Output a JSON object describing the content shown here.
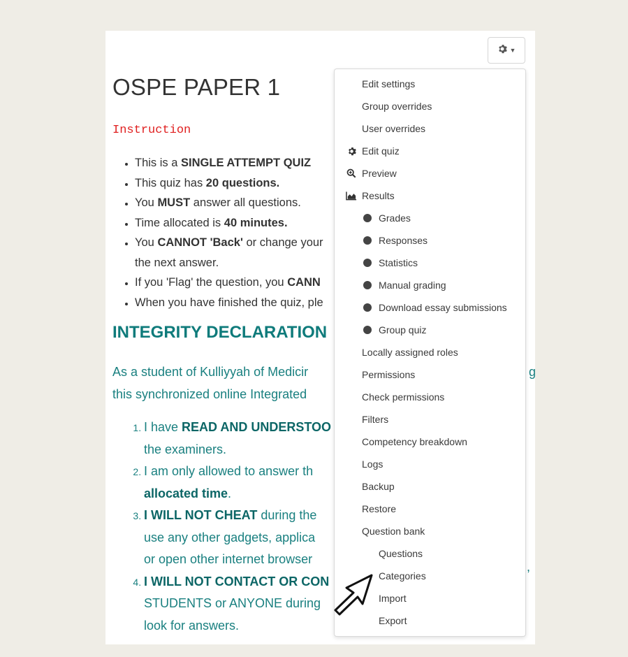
{
  "page_title": "OSPE PAPER 1",
  "instruction_label": "Instruction",
  "rules": [
    [
      "This is a ",
      "SINGLE ATTEMPT QUIZ",
      ""
    ],
    [
      "This quiz has ",
      "20 questions.",
      ""
    ],
    [
      "You ",
      "MUST",
      " answer all questions."
    ],
    [
      "Time allocated is ",
      "40 minutes.",
      ""
    ],
    [
      "You ",
      "CANNOT 'Back'",
      " or change your"
    ],
    [
      "the next answer.",
      "",
      ""
    ],
    [
      "If you 'Flag' the question, you ",
      "CANN",
      ""
    ],
    [
      "When you have finished the quiz, ple",
      "",
      ""
    ]
  ],
  "integrity_heading": "INTEGRITY DECLARATION",
  "declaration_line1": "As a student of Kulliyyah of Medicir",
  "declaration_line1_tail": "g",
  "declaration_line2": "this synchronized online Integrated",
  "pledges": [
    {
      "lines": [
        [
          "I have ",
          "READ AND UNDERSTOO",
          ""
        ],
        [
          "the examiners.",
          "",
          ""
        ]
      ]
    },
    {
      "lines": [
        [
          "I am only allowed to answer th",
          "",
          ""
        ],
        [
          "",
          "allocated time",
          "."
        ]
      ]
    },
    {
      "lines": [
        [
          "",
          "I WILL NOT CHEAT",
          " during the"
        ],
        [
          "use any other gadgets, applica",
          "",
          ""
        ],
        [
          "or open other internet browser",
          "",
          ""
        ]
      ]
    },
    {
      "lines": [
        [
          "",
          "I WILL NOT CONTACT OR CON",
          ""
        ],
        [
          "STUDENTS or ANYONE during",
          "",
          ""
        ],
        [
          "look for answers.",
          "",
          ""
        ]
      ]
    }
  ],
  "pledge_tail_comma": ",",
  "menu": {
    "items": [
      {
        "label": "Edit settings",
        "level": 0,
        "icon": ""
      },
      {
        "label": "Group overrides",
        "level": 0,
        "icon": ""
      },
      {
        "label": "User overrides",
        "level": 0,
        "icon": ""
      },
      {
        "label": "Edit quiz",
        "level": 0,
        "icon": "gear-icon"
      },
      {
        "label": "Preview",
        "level": 0,
        "icon": "zoom-icon"
      },
      {
        "label": "Results",
        "level": 0,
        "icon": "area-chart-icon"
      },
      {
        "label": "Grades",
        "level": 1,
        "icon": "dot"
      },
      {
        "label": "Responses",
        "level": 1,
        "icon": "dot"
      },
      {
        "label": "Statistics",
        "level": 1,
        "icon": "dot"
      },
      {
        "label": "Manual grading",
        "level": 1,
        "icon": "dot"
      },
      {
        "label": "Download essay submissions",
        "level": 1,
        "icon": "dot"
      },
      {
        "label": "Group quiz",
        "level": 1,
        "icon": "dot"
      },
      {
        "label": "Locally assigned roles",
        "level": 0,
        "icon": ""
      },
      {
        "label": "Permissions",
        "level": 0,
        "icon": ""
      },
      {
        "label": "Check permissions",
        "level": 0,
        "icon": ""
      },
      {
        "label": "Filters",
        "level": 0,
        "icon": ""
      },
      {
        "label": "Competency breakdown",
        "level": 0,
        "icon": ""
      },
      {
        "label": "Logs",
        "level": 0,
        "icon": ""
      },
      {
        "label": "Backup",
        "level": 0,
        "icon": ""
      },
      {
        "label": "Restore",
        "level": 0,
        "icon": ""
      },
      {
        "label": "Question bank",
        "level": 0,
        "icon": ""
      },
      {
        "label": "Questions",
        "level": 1,
        "icon": ""
      },
      {
        "label": "Categories",
        "level": 1,
        "icon": ""
      },
      {
        "label": "Import",
        "level": 1,
        "icon": ""
      },
      {
        "label": "Export",
        "level": 1,
        "icon": ""
      }
    ]
  },
  "colors": {
    "accent_teal": "#1a8080",
    "heading_teal": "#0f7b7b",
    "instruction_red": "#e02020",
    "background": "#efede6"
  }
}
